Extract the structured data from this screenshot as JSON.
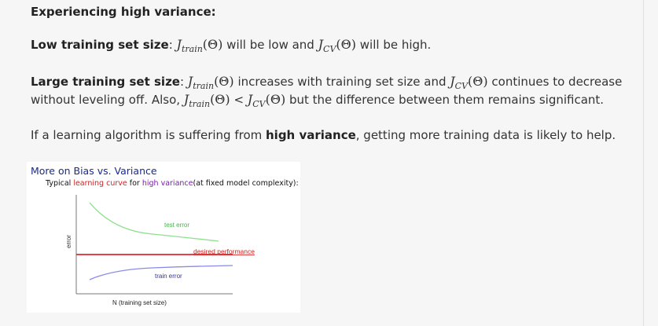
{
  "heading": "Experiencing high variance:",
  "low": {
    "label": "Low training set size",
    "j_train": "J",
    "j_train_sub": "train",
    "theta": "(Θ)",
    "t1": " will be low and ",
    "j_cv": "J",
    "j_cv_sub": "CV",
    "t2": " will be high."
  },
  "large": {
    "label": "Large training set size",
    "t1": " increases with training set size and ",
    "t2": " continues to decrease",
    "line2a": "without leveling off. Also, ",
    "lt": " < ",
    "line2b": " but the difference between them remains significant."
  },
  "conclusion": {
    "t1": "If a learning algorithm is suffering from ",
    "bold": "high variance",
    "t2": ", getting more training data is likely to help."
  },
  "figure": {
    "title": "More on Bias vs. Variance",
    "sub_a": "Typical ",
    "sub_red": "learning curve",
    "sub_b": " for ",
    "sub_purple": "high variance",
    "sub_c": "(at fixed model complexity):",
    "test_error": "test error",
    "desired": "desired performance",
    "train_error": "train error",
    "ylabel": "error",
    "xlabel": "N (training set size)",
    "colors": {
      "test": "#8ee08e",
      "desired": "#e8404a",
      "train": "#8a8ae8"
    }
  }
}
